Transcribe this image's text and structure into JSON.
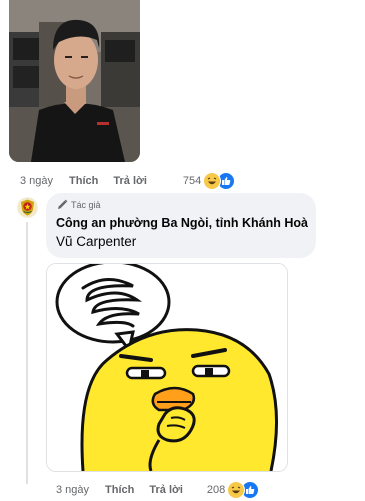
{
  "comment_1": {
    "age": "3 ngày",
    "like_label": "Thích",
    "reply_label": "Trả lời",
    "reaction_count": "754",
    "reactions": [
      "haha-icon",
      "like-icon"
    ]
  },
  "reply_1": {
    "author_badge": "Tác giả",
    "author_name": "Công an phường Ba Ngòi, tỉnh Khánh Hoà",
    "text": "Vũ Carpenter",
    "age": "3 ngày",
    "like_label": "Thích",
    "reply_label": "Trả lời",
    "reaction_count": "208",
    "reactions": [
      "haha-icon",
      "like-icon"
    ]
  },
  "colors": {
    "meta_text": "#65676b",
    "bubble_bg": "#f0f2f5",
    "like_blue": "#1877f2",
    "haha_yellow": "#f7c948"
  }
}
